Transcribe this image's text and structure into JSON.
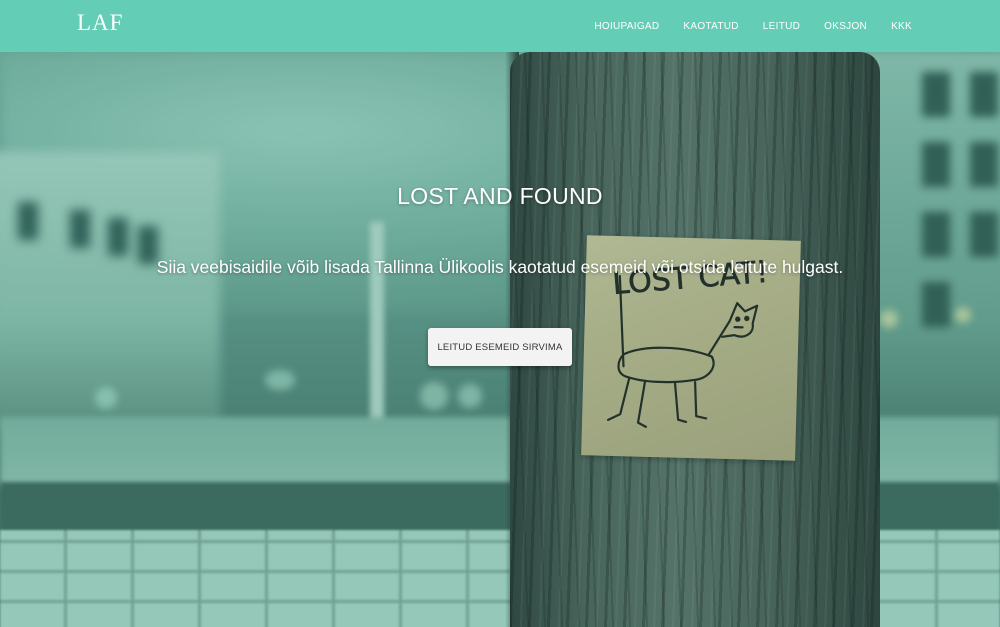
{
  "navbar": {
    "brand": "LAF",
    "links": [
      {
        "label": "HOIUPAIGAD"
      },
      {
        "label": "KAOTATUD"
      },
      {
        "label": "LEITUD"
      },
      {
        "label": "OKSJON"
      },
      {
        "label": "KKK"
      }
    ]
  },
  "hero": {
    "title": "LOST AND FOUND",
    "subtitle": "Siia veebisaidile võib lisada Tallinna Ülikoolis kaotatud esemeid või otsida leitute hulgast.",
    "button_label": "LEITUD ESEMEID SIRVIMA",
    "sign_text": "LOST CAT!"
  },
  "colors": {
    "navbar_bg": "#64cdb5",
    "nav_text": "#ffffff",
    "button_bg": "#f3f3f3",
    "button_text": "#333333"
  }
}
